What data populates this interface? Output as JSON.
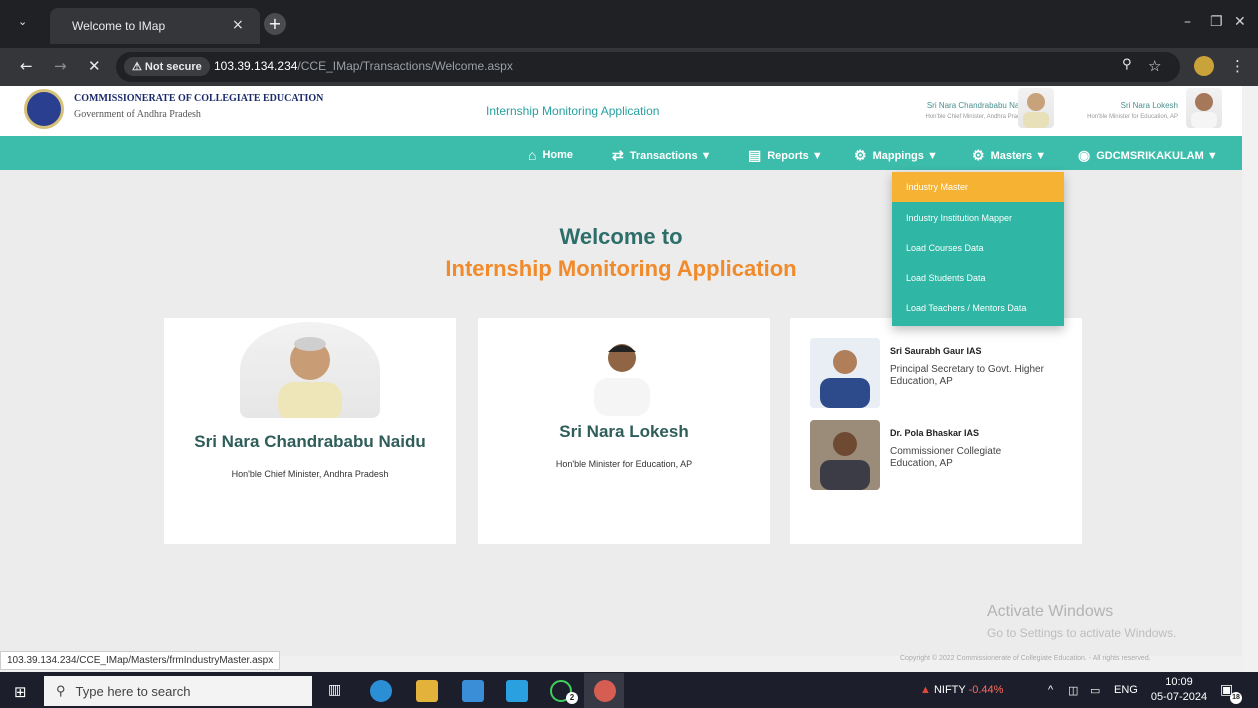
{
  "browser": {
    "tab_title": "Welcome to IMap",
    "tab_close": "×",
    "new_tab": "+",
    "security": "⚠ Not secure",
    "url_host": "103.39.134.234",
    "url_path": "/CCE_IMap/Transactions/Welcome.aspx",
    "status_url": "103.39.134.234/CCE_IMap/Masters/frmIndustryMaster.aspx"
  },
  "header": {
    "org_name": "COMMISSIONERATE OF COLLEGIATE EDUCATION",
    "org_sub": "Government of Andhra Pradesh",
    "app_title": "Internship Monitoring Application",
    "cm_name": "Sri Nara Chandrababu Naidu",
    "cm_role": "Hon'ble Chief Minister, Andhra Pradesh",
    "min_name": "Sri Nara Lokesh",
    "min_role": "Hon'ble Minister for Education, AP"
  },
  "nav": {
    "home": "Home",
    "transactions": "Transactions ▼",
    "reports": "Reports ▼",
    "mappings": "Mappings ▼",
    "masters": "Masters ▼",
    "user": "GDCMSRIKAKULAM ▼"
  },
  "mappings_menu": [
    "Industry Master",
    "Industry Institution Mapper",
    "Load Courses Data",
    "Load Students Data",
    "Load Teachers / Mentors Data"
  ],
  "welcome": {
    "line1": "Welcome to",
    "line2": "Internship Monitoring Application"
  },
  "cards": {
    "cm": {
      "name": "Sri Nara Chandrababu Naidu",
      "role": "Hon'ble Chief Minister, Andhra Pradesh"
    },
    "minister": {
      "name": "Sri Nara Lokesh",
      "role": "Hon'ble Minister for Education, AP"
    },
    "officials": [
      {
        "name": "Sri Saurabh Gaur IAS",
        "role": "Principal Secretary to Govt. Higher Education, AP"
      },
      {
        "name": "Dr. Pola Bhaskar IAS",
        "role": "Commissioner Collegiate Education, AP"
      }
    ]
  },
  "footer": {
    "copyright": "Copyright © 2022 Commissionerate of Collegiate Education. - All rights reserved.",
    "activate_title": "Activate Windows",
    "activate_sub": "Go to Settings to activate Windows."
  },
  "taskbar": {
    "search_placeholder": "Type here to search",
    "nifty_label": "NIFTY",
    "nifty_change": "-0.44%",
    "lang": "ENG",
    "time": "10:09",
    "date": "05-07-2024",
    "notif_count": "18",
    "whatsapp_badge": "2"
  },
  "colors": {
    "nav_bg": "#3cbcaa",
    "menu_active": "#f5b233",
    "welcome_teal": "#2e6e6a",
    "welcome_orange": "#f08a2a"
  }
}
